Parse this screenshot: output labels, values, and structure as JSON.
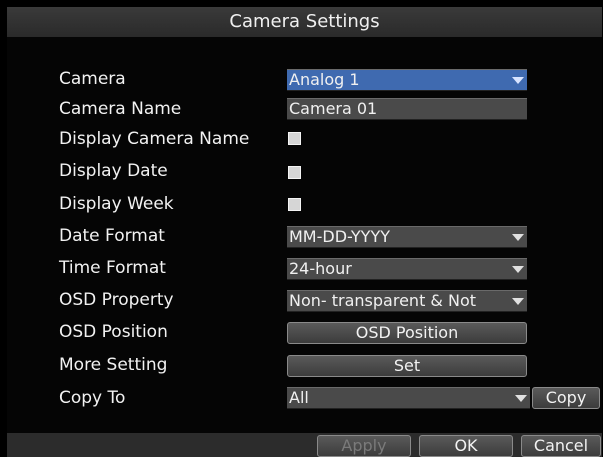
{
  "window": {
    "title": "Camera Settings"
  },
  "rows": {
    "camera": {
      "label": "Camera",
      "value": "Analog 1"
    },
    "camera_name": {
      "label": "Camera Name",
      "value": "Camera 01"
    },
    "display_camera_name": {
      "label": "Display Camera Name",
      "checked": true
    },
    "display_date": {
      "label": "Display Date",
      "checked": true
    },
    "display_week": {
      "label": "Display Week",
      "checked": true
    },
    "date_format": {
      "label": "Date Format",
      "value": "MM-DD-YYYY"
    },
    "time_format": {
      "label": "Time Format",
      "value": "24-hour"
    },
    "osd_property": {
      "label": "OSD Property",
      "value": "Non- transparent & Not"
    },
    "osd_position": {
      "label": "OSD Position",
      "button_label": "OSD Position"
    },
    "more_setting": {
      "label": "More Setting",
      "button_label": "Set"
    },
    "copy_to": {
      "label": "Copy To",
      "value": "All",
      "button_label": "Copy"
    }
  },
  "footer": {
    "apply_label": "Apply",
    "ok_label": "OK",
    "cancel_label": "Cancel"
  },
  "colors": {
    "selected_field": "#3f6ab0",
    "field": "#4a4a4a",
    "background": "#050505"
  }
}
